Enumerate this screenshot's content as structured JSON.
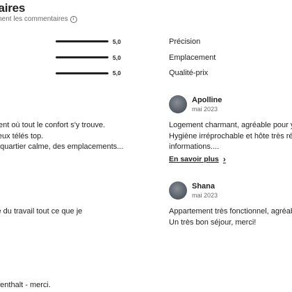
{
  "header": {
    "title": "taires",
    "subtitle": "onnent les commentaires",
    "info_icon": "info-icon"
  },
  "ratings": [
    {
      "score": "5,0",
      "label": "Précision",
      "value": 5.0
    },
    {
      "score": "5,0",
      "label": "Emplacement",
      "value": 5.0
    },
    {
      "score": "5,0",
      "label": "Qualité-prix",
      "value": 5.0
    }
  ],
  "left_reviews": {
    "r1_line1": "ent où tout le confort s'y trouve.",
    "r1_line2": "lleux télés top.",
    "r1_line3": "t quartier calme, des emplacements...",
    "r2_line1": "ité du travail tout ce que je",
    "r3_line1": "ufenthalt - merci."
  },
  "right_reviews": [
    {
      "name": "Apolline",
      "date": "mai 2023",
      "line1": "Logement charmant, agréable pour y s",
      "line2": "Hygiène irréprochable et hôte très réa",
      "line3": "informations....",
      "more_label": "En savoir plus"
    },
    {
      "name": "Shana",
      "date": "mai 2023",
      "line1": "Appartement très fonctionnel, agréab",
      "line2": "Un très bon séjour, merci!"
    }
  ]
}
